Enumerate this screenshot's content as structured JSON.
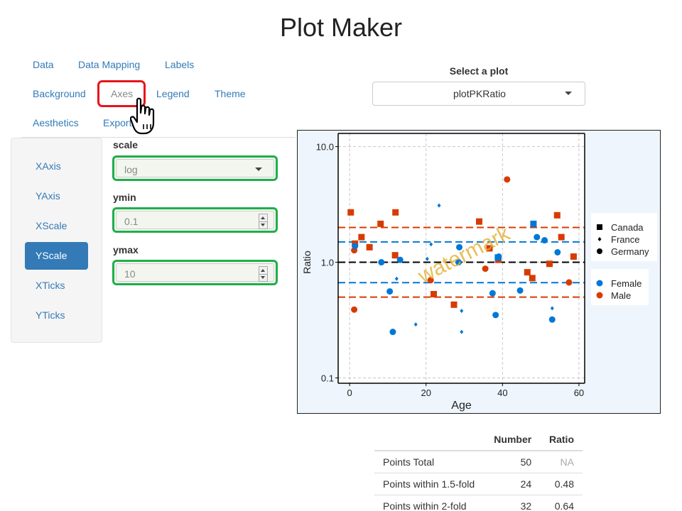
{
  "app": {
    "title": "Plot Maker"
  },
  "tabs": [
    {
      "label": "Data",
      "active": false
    },
    {
      "label": "Data Mapping",
      "active": false
    },
    {
      "label": "Labels",
      "active": false
    },
    {
      "label": "Background",
      "active": false
    },
    {
      "label": "Axes",
      "active": true
    },
    {
      "label": "Legend",
      "active": false
    },
    {
      "label": "Theme",
      "active": false
    },
    {
      "label": "Aesthetics",
      "active": false
    },
    {
      "label": "Export",
      "active": false
    }
  ],
  "side_nav": [
    {
      "label": "XAxis",
      "active": false
    },
    {
      "label": "YAxis",
      "active": false
    },
    {
      "label": "XScale",
      "active": false
    },
    {
      "label": "YScale",
      "active": true
    },
    {
      "label": "XTicks",
      "active": false
    },
    {
      "label": "YTicks",
      "active": false
    }
  ],
  "fields": {
    "scale": {
      "label": "scale",
      "value": "log"
    },
    "ymin": {
      "label": "ymin",
      "value": "0.1"
    },
    "ymax": {
      "label": "ymax",
      "value": "10"
    }
  },
  "plot_select": {
    "label": "Select a plot",
    "value": "plotPKRatio"
  },
  "colors": {
    "accent": "#337ab7",
    "female": "#0078d7",
    "male": "#d83b01",
    "highlight_red": "#e8141c",
    "highlight_green": "#1fae4b",
    "watermark": "#e6b33d",
    "plot_bg": "#eef5fd"
  },
  "icons": {
    "pointer": "hand-pointer-icon",
    "dropdown": "chevron-down-icon",
    "spinner": "number-spinner-icon"
  },
  "chart_data": {
    "type": "scatter",
    "xlabel": "Age",
    "ylabel": "Ratio",
    "y_scale": "log",
    "xlim": [
      -3,
      61.5
    ],
    "ylim": [
      0.09,
      13
    ],
    "x_ticks": [
      0,
      20,
      40,
      60
    ],
    "y_ticks": [
      0.1,
      1.0,
      10.0
    ],
    "x_tick_labels": [
      "0",
      "20",
      "40",
      "60"
    ],
    "y_tick_labels": [
      "0.1",
      "1.0",
      "10.0"
    ],
    "grid": true,
    "watermark": "watermark",
    "reference_lines": [
      {
        "value": 1.0,
        "color": "#000000"
      },
      {
        "value": 1.5,
        "color": "#0078d7"
      },
      {
        "value": 0.667,
        "color": "#0078d7"
      },
      {
        "value": 2.0,
        "color": "#d83b01"
      },
      {
        "value": 0.5,
        "color": "#d83b01"
      }
    ],
    "legend_groups": [
      {
        "title_shape_legend": true,
        "entries": [
          {
            "label": "Canada",
            "shape": "square"
          },
          {
            "label": "France",
            "shape": "diamond"
          },
          {
            "label": "Germany",
            "shape": "circle"
          }
        ]
      },
      {
        "entries": [
          {
            "label": "Female",
            "color": "#0078d7"
          },
          {
            "label": "Male",
            "color": "#d83b01"
          }
        ]
      }
    ],
    "legend_position": "right",
    "points": [
      {
        "x": 0.3,
        "y": 2.7,
        "shape": "square",
        "sex": "Male"
      },
      {
        "x": 1.4,
        "y": 1.45,
        "shape": "square",
        "sex": "Male"
      },
      {
        "x": 3.1,
        "y": 1.65,
        "shape": "square",
        "sex": "Male"
      },
      {
        "x": 5.2,
        "y": 1.35,
        "shape": "square",
        "sex": "Male"
      },
      {
        "x": 8.1,
        "y": 2.15,
        "shape": "square",
        "sex": "Male"
      },
      {
        "x": 12.0,
        "y": 2.7,
        "shape": "square",
        "sex": "Male"
      },
      {
        "x": 11.9,
        "y": 1.15,
        "shape": "square",
        "sex": "Male"
      },
      {
        "x": 22.0,
        "y": 0.53,
        "shape": "square",
        "sex": "Male"
      },
      {
        "x": 27.3,
        "y": 0.43,
        "shape": "square",
        "sex": "Male"
      },
      {
        "x": 33.9,
        "y": 2.25,
        "shape": "square",
        "sex": "Male"
      },
      {
        "x": 36.6,
        "y": 1.32,
        "shape": "square",
        "sex": "Male"
      },
      {
        "x": 46.5,
        "y": 0.82,
        "shape": "square",
        "sex": "Male"
      },
      {
        "x": 47.8,
        "y": 0.73,
        "shape": "square",
        "sex": "Male"
      },
      {
        "x": 52.3,
        "y": 0.97,
        "shape": "square",
        "sex": "Male"
      },
      {
        "x": 54.3,
        "y": 2.55,
        "shape": "square",
        "sex": "Male"
      },
      {
        "x": 55.4,
        "y": 1.65,
        "shape": "square",
        "sex": "Male"
      },
      {
        "x": 58.6,
        "y": 1.12,
        "shape": "square",
        "sex": "Male"
      },
      {
        "x": 38.9,
        "y": 1.05,
        "shape": "square",
        "sex": "Male"
      },
      {
        "x": 48.1,
        "y": 2.15,
        "shape": "square",
        "sex": "Female"
      },
      {
        "x": 38.8,
        "y": 1.1,
        "shape": "square",
        "sex": "Female"
      },
      {
        "x": 1.2,
        "y": 0.39,
        "shape": "circle",
        "sex": "Male"
      },
      {
        "x": 1.2,
        "y": 1.27,
        "shape": "circle",
        "sex": "Male"
      },
      {
        "x": 21.2,
        "y": 0.7,
        "shape": "circle",
        "sex": "Male"
      },
      {
        "x": 35.5,
        "y": 0.88,
        "shape": "circle",
        "sex": "Male"
      },
      {
        "x": 41.2,
        "y": 5.2,
        "shape": "circle",
        "sex": "Male"
      },
      {
        "x": 57.4,
        "y": 0.67,
        "shape": "circle",
        "sex": "Male"
      },
      {
        "x": 1.4,
        "y": 1.38,
        "shape": "circle",
        "sex": "Female"
      },
      {
        "x": 8.3,
        "y": 1.0,
        "shape": "circle",
        "sex": "Female"
      },
      {
        "x": 10.5,
        "y": 0.56,
        "shape": "circle",
        "sex": "Female"
      },
      {
        "x": 11.3,
        "y": 0.25,
        "shape": "circle",
        "sex": "Female"
      },
      {
        "x": 13.2,
        "y": 1.05,
        "shape": "circle",
        "sex": "Female"
      },
      {
        "x": 28.7,
        "y": 1.35,
        "shape": "circle",
        "sex": "Female"
      },
      {
        "x": 28.5,
        "y": 1.0,
        "shape": "circle",
        "sex": "Female"
      },
      {
        "x": 37.4,
        "y": 0.54,
        "shape": "circle",
        "sex": "Female"
      },
      {
        "x": 38.2,
        "y": 0.35,
        "shape": "circle",
        "sex": "Female"
      },
      {
        "x": 39.0,
        "y": 1.12,
        "shape": "circle",
        "sex": "Female"
      },
      {
        "x": 44.6,
        "y": 0.57,
        "shape": "circle",
        "sex": "Female"
      },
      {
        "x": 49.0,
        "y": 1.65,
        "shape": "circle",
        "sex": "Female"
      },
      {
        "x": 51.0,
        "y": 1.55,
        "shape": "circle",
        "sex": "Female"
      },
      {
        "x": 53.0,
        "y": 0.32,
        "shape": "circle",
        "sex": "Female"
      },
      {
        "x": 54.4,
        "y": 1.22,
        "shape": "circle",
        "sex": "Female"
      },
      {
        "x": 12.3,
        "y": 0.72,
        "shape": "diamond",
        "sex": "Female"
      },
      {
        "x": 17.3,
        "y": 0.29,
        "shape": "diamond",
        "sex": "Female"
      },
      {
        "x": 20.3,
        "y": 1.07,
        "shape": "diamond",
        "sex": "Female"
      },
      {
        "x": 21.3,
        "y": 1.43,
        "shape": "diamond",
        "sex": "Female"
      },
      {
        "x": 23.4,
        "y": 3.1,
        "shape": "diamond",
        "sex": "Female"
      },
      {
        "x": 29.3,
        "y": 0.38,
        "shape": "diamond",
        "sex": "Female"
      },
      {
        "x": 29.3,
        "y": 0.25,
        "shape": "diamond",
        "sex": "Female"
      },
      {
        "x": 53.0,
        "y": 0.4,
        "shape": "diamond",
        "sex": "Female"
      },
      {
        "x": 48.0,
        "y": 2.2,
        "shape": "diamond",
        "sex": "Female"
      }
    ]
  },
  "summary_table": {
    "headers": [
      "",
      "Number",
      "Ratio"
    ],
    "rows": [
      {
        "label": "Points Total",
        "number": "50",
        "ratio": "NA"
      },
      {
        "label": "Points within 1.5-fold",
        "number": "24",
        "ratio": "0.48"
      },
      {
        "label": "Points within 2-fold",
        "number": "32",
        "ratio": "0.64"
      }
    ]
  }
}
